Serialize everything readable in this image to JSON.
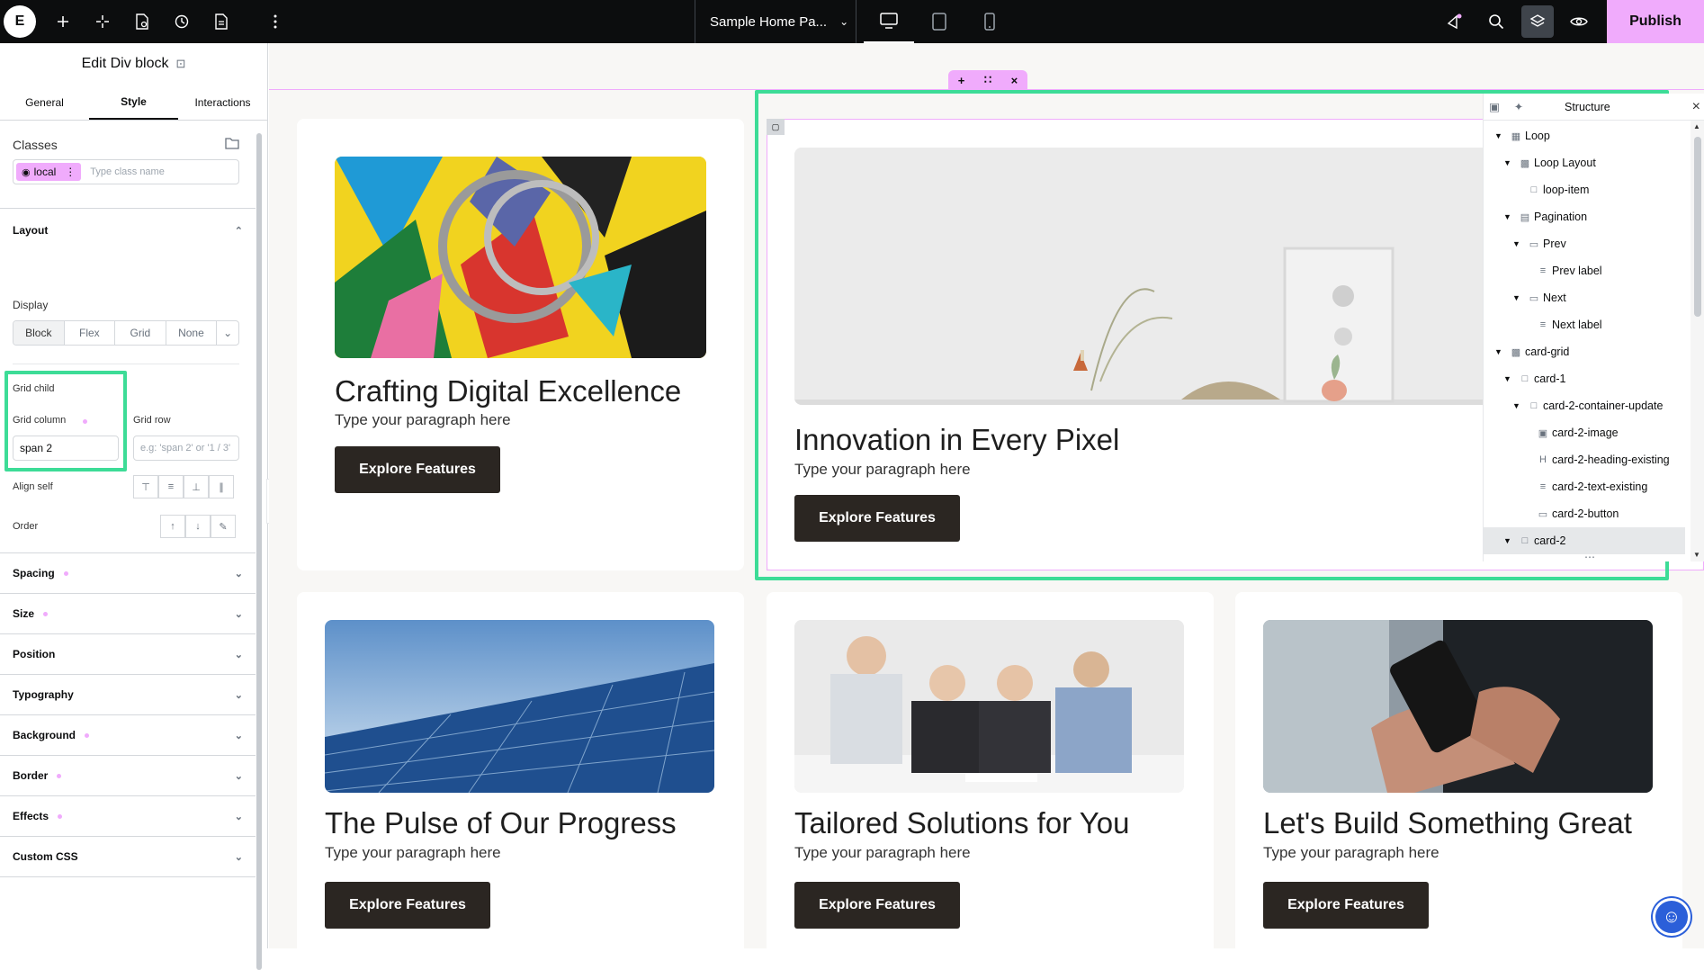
{
  "topbar": {
    "logo": "E",
    "page_name": "Sample Home Pa...",
    "publish_label": "Publish",
    "icons": [
      "add-icon",
      "sparkle-icon",
      "page-settings-icon",
      "history-icon",
      "document-icon",
      "more-icon"
    ]
  },
  "panel": {
    "title": "Edit Div block",
    "tabs": [
      "General",
      "Style",
      "Interactions"
    ],
    "classes_label": "Classes",
    "class_chip": "local",
    "class_placeholder": "Type class name",
    "layout_label": "Layout",
    "display_label": "Display",
    "display_options": [
      "Block",
      "Flex",
      "Grid",
      "None"
    ],
    "grid_child_label": "Grid child",
    "grid_column_label": "Grid column",
    "grid_column_value": "span 2",
    "grid_row_label": "Grid row",
    "grid_row_placeholder": "e.g: 'span 2' or '1 / 3'",
    "align_self_label": "Align self",
    "order_label": "Order",
    "sections": [
      "Spacing",
      "Size",
      "Position",
      "Typography",
      "Background",
      "Border",
      "Effects",
      "Custom CSS"
    ]
  },
  "canvas": {
    "cards": [
      {
        "title": "Crafting Digital Excellence",
        "text": "Type your paragraph here",
        "button": "Explore Features"
      },
      {
        "title": "Innovation in Every Pixel",
        "text": "Type your paragraph here",
        "button": "Explore Features"
      },
      {
        "title": "The Pulse of Our Progress",
        "text": "Type your paragraph here",
        "button": "Explore Features"
      },
      {
        "title": "Tailored Solutions for You",
        "text": "Type your paragraph here",
        "button": "Explore Features"
      },
      {
        "title": "Let's Build Something Great",
        "text": "Type your paragraph here",
        "button": "Explore Features"
      }
    ]
  },
  "structure": {
    "title": "Structure",
    "items": [
      {
        "label": "Loop",
        "level": 0
      },
      {
        "label": "Loop Layout",
        "level": 1
      },
      {
        "label": "loop-item",
        "level": 2
      },
      {
        "label": "Pagination",
        "level": 1
      },
      {
        "label": "Prev",
        "level": 2
      },
      {
        "label": "Prev label",
        "level": 3
      },
      {
        "label": "Next",
        "level": 2
      },
      {
        "label": "Next label",
        "level": 3
      },
      {
        "label": "card-grid",
        "level": 0
      },
      {
        "label": "card-1",
        "level": 1
      },
      {
        "label": "card-2-container-update",
        "level": 2
      },
      {
        "label": "card-2-image",
        "level": 3
      },
      {
        "label": "card-2-heading-existing",
        "level": 3
      },
      {
        "label": "card-2-text-existing",
        "level": 3
      },
      {
        "label": "card-2-button",
        "level": 3
      },
      {
        "label": "card-2",
        "level": 1
      }
    ]
  },
  "colors": {
    "accent": "#f0abfc",
    "highlight": "#3ddc97",
    "dark": "#0c0d0e",
    "button": "#2b2622"
  }
}
